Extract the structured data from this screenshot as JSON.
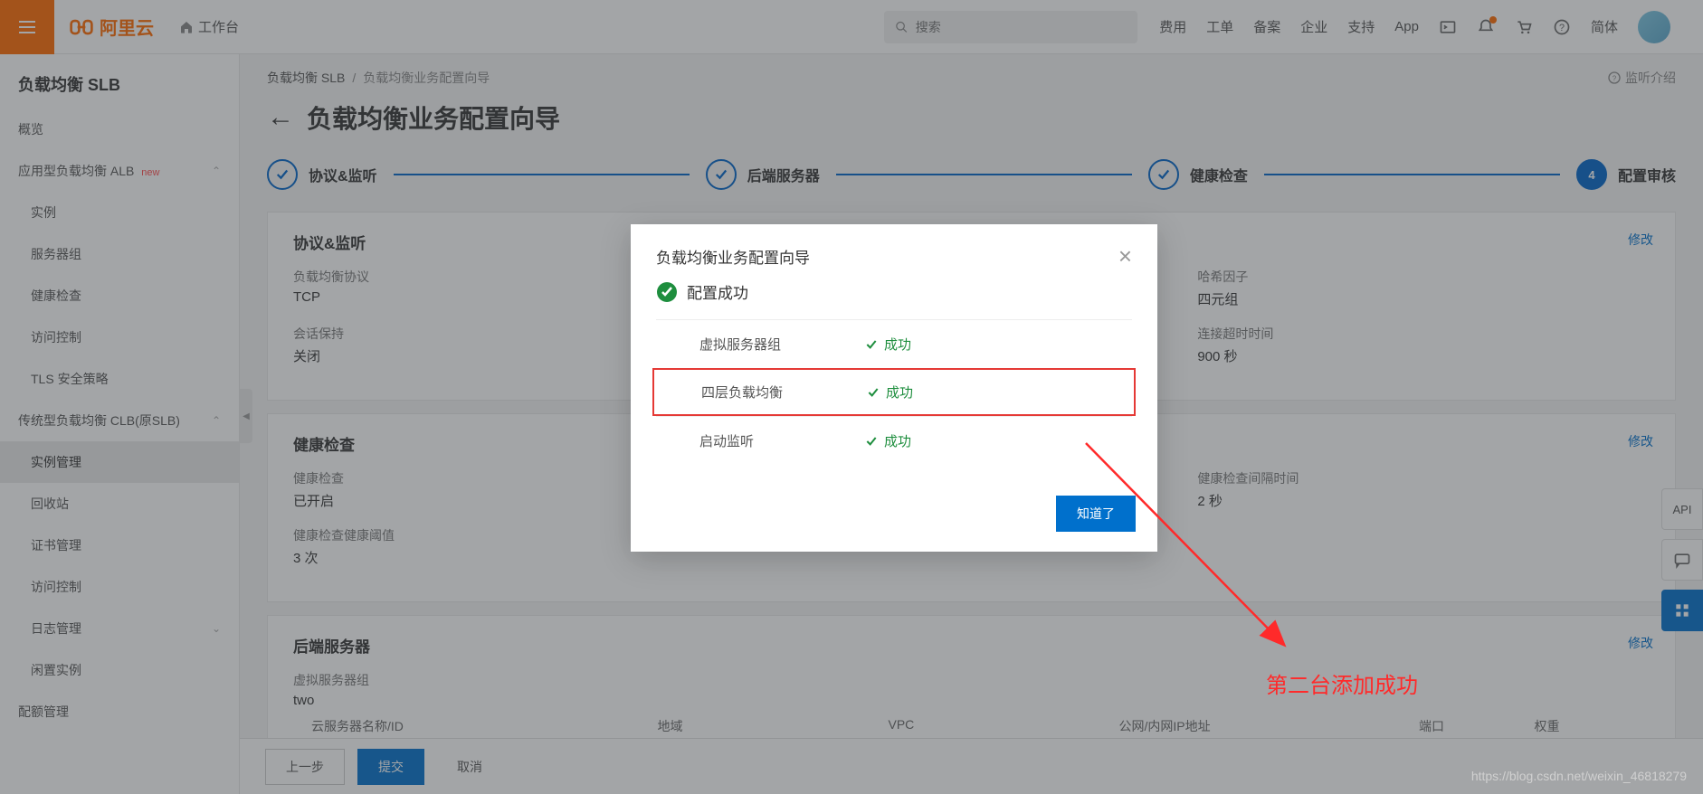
{
  "topbar": {
    "brand": "阿里云",
    "workbench": "工作台",
    "search_placeholder": "搜索",
    "links": [
      "费用",
      "工单",
      "备案",
      "企业",
      "支持",
      "App"
    ],
    "lang": "简体"
  },
  "sidebar": {
    "title": "负载均衡 SLB",
    "items": [
      {
        "label": "概览",
        "sub": false
      },
      {
        "label": "应用型负载均衡 ALB",
        "sub": false,
        "badge": "new",
        "expand": true
      },
      {
        "label": "实例",
        "sub": true
      },
      {
        "label": "服务器组",
        "sub": true
      },
      {
        "label": "健康检查",
        "sub": true
      },
      {
        "label": "访问控制",
        "sub": true
      },
      {
        "label": "TLS 安全策略",
        "sub": true
      },
      {
        "label": "传统型负载均衡 CLB(原SLB)",
        "sub": false,
        "expand": true
      },
      {
        "label": "实例管理",
        "sub": true,
        "active": true
      },
      {
        "label": "回收站",
        "sub": true
      },
      {
        "label": "证书管理",
        "sub": true
      },
      {
        "label": "访问控制",
        "sub": true
      },
      {
        "label": "日志管理",
        "sub": true,
        "expand": true,
        "chev": "down"
      },
      {
        "label": "闲置实例",
        "sub": true
      },
      {
        "label": "配额管理",
        "sub": false
      }
    ]
  },
  "breadcrumb": {
    "a": "负载均衡 SLB",
    "b": "负载均衡业务配置向导"
  },
  "listen_intro": "监听介绍",
  "page_title": "负载均衡业务配置向导",
  "steps": [
    "协议&监听",
    "后端服务器",
    "健康检查",
    "配置审核"
  ],
  "card_edit": "修改",
  "cards": {
    "proto": {
      "title": "协议&监听",
      "rows": [
        {
          "l1": "负载均衡协议",
          "v1": "TCP",
          "l2": "哈希因子",
          "v2": "四元组"
        },
        {
          "l1": "会话保持",
          "v1": "关闭",
          "l2": "连接超时时间",
          "v2": "900 秒"
        }
      ]
    },
    "health": {
      "title": "健康检查",
      "rows": [
        {
          "l1": "健康检查",
          "v1": "已开启",
          "l2": "健康检查间隔时间",
          "v2": "2 秒"
        },
        {
          "l1": "健康检查健康阈值",
          "v1": "3 次",
          "l2": "",
          "v2": ""
        }
      ]
    },
    "backend": {
      "title": "后端服务器",
      "group_label": "虚拟服务器组",
      "group_value": "two",
      "columns": [
        "云服务器名称/ID",
        "地域",
        "VPC",
        "公网/内网IP地址",
        "端口",
        "权重"
      ]
    }
  },
  "footer": {
    "prev": "上一步",
    "submit": "提交",
    "cancel": "取消"
  },
  "sidetools": {
    "api": "API"
  },
  "modal": {
    "title": "负载均衡业务配置向导",
    "success": "配置成功",
    "rows": [
      {
        "label": "虚拟服务器组",
        "status": "成功",
        "highlight": false
      },
      {
        "label": "四层负载均衡",
        "status": "成功",
        "highlight": true
      },
      {
        "label": "启动监听",
        "status": "成功",
        "highlight": false
      }
    ],
    "ok": "知道了"
  },
  "annotation": "第二台添加成功",
  "watermark": "https://blog.csdn.net/weixin_46818279"
}
